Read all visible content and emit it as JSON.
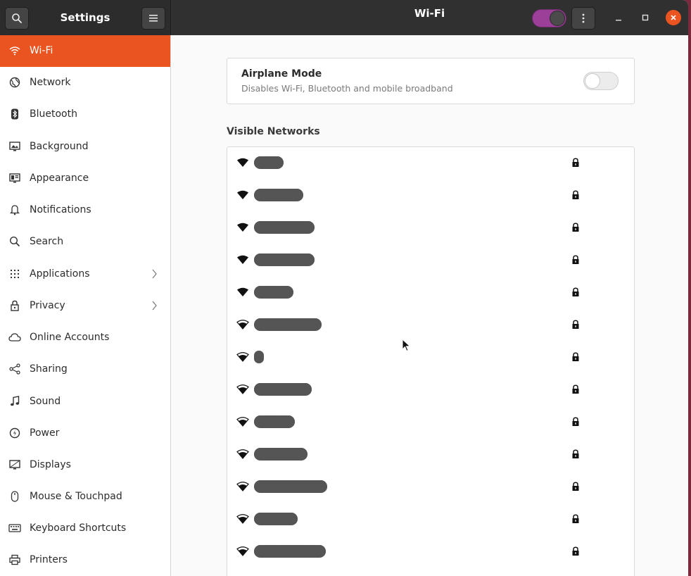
{
  "header": {
    "app_title": "Settings",
    "page_title": "Wi-Fi",
    "search_icon": "search-icon",
    "menu_icon": "hamburger-icon",
    "wifi_toggle_on": true,
    "more_icon": "vertical-dots-icon"
  },
  "sidebar": {
    "items": [
      {
        "label": "Wi-Fi",
        "icon": "wifi-icon",
        "active": true
      },
      {
        "label": "Network",
        "icon": "globe-icon"
      },
      {
        "label": "Bluetooth",
        "icon": "bluetooth-icon"
      },
      {
        "label": "Background",
        "icon": "monitor-icon"
      },
      {
        "label": "Appearance",
        "icon": "appearance-icon"
      },
      {
        "label": "Notifications",
        "icon": "bell-icon"
      },
      {
        "label": "Search",
        "icon": "search-icon"
      },
      {
        "label": "Applications",
        "icon": "grid-icon",
        "chevron": true
      },
      {
        "label": "Privacy",
        "icon": "lock-icon",
        "chevron": true
      },
      {
        "label": "Online Accounts",
        "icon": "cloud-icon"
      },
      {
        "label": "Sharing",
        "icon": "share-icon"
      },
      {
        "label": "Sound",
        "icon": "music-note-icon"
      },
      {
        "label": "Power",
        "icon": "power-icon"
      },
      {
        "label": "Displays",
        "icon": "display-icon"
      },
      {
        "label": "Mouse & Touchpad",
        "icon": "mouse-icon"
      },
      {
        "label": "Keyboard Shortcuts",
        "icon": "keyboard-icon"
      },
      {
        "label": "Printers",
        "icon": "printer-icon"
      }
    ]
  },
  "airplane": {
    "title": "Airplane Mode",
    "subtitle": "Disables Wi-Fi, Bluetooth and mobile broadband",
    "enabled": false
  },
  "networks": {
    "title": "Visible Networks",
    "items": [
      {
        "ssid": "██████",
        "signal": "full",
        "secured": true
      },
      {
        "ssid": "█████████",
        "signal": "full",
        "secured": true
      },
      {
        "ssid": "███████████",
        "signal": "full",
        "secured": true
      },
      {
        "ssid": "███████████",
        "signal": "full",
        "secured": true
      },
      {
        "ssid": "███████",
        "signal": "full",
        "secured": true
      },
      {
        "ssid": "████████████",
        "signal": "good",
        "secured": true
      },
      {
        "ssid": "██",
        "signal": "good",
        "secured": true
      },
      {
        "ssid": "███████████",
        "signal": "good",
        "secured": true
      },
      {
        "ssid": "████████",
        "signal": "good",
        "secured": true
      },
      {
        "ssid": "██████████",
        "signal": "good",
        "secured": true
      },
      {
        "ssid": "█████████████",
        "signal": "good",
        "secured": true
      },
      {
        "ssid": "████████",
        "signal": "good",
        "secured": true
      },
      {
        "ssid": "█████████████",
        "signal": "good",
        "secured": true
      }
    ]
  }
}
